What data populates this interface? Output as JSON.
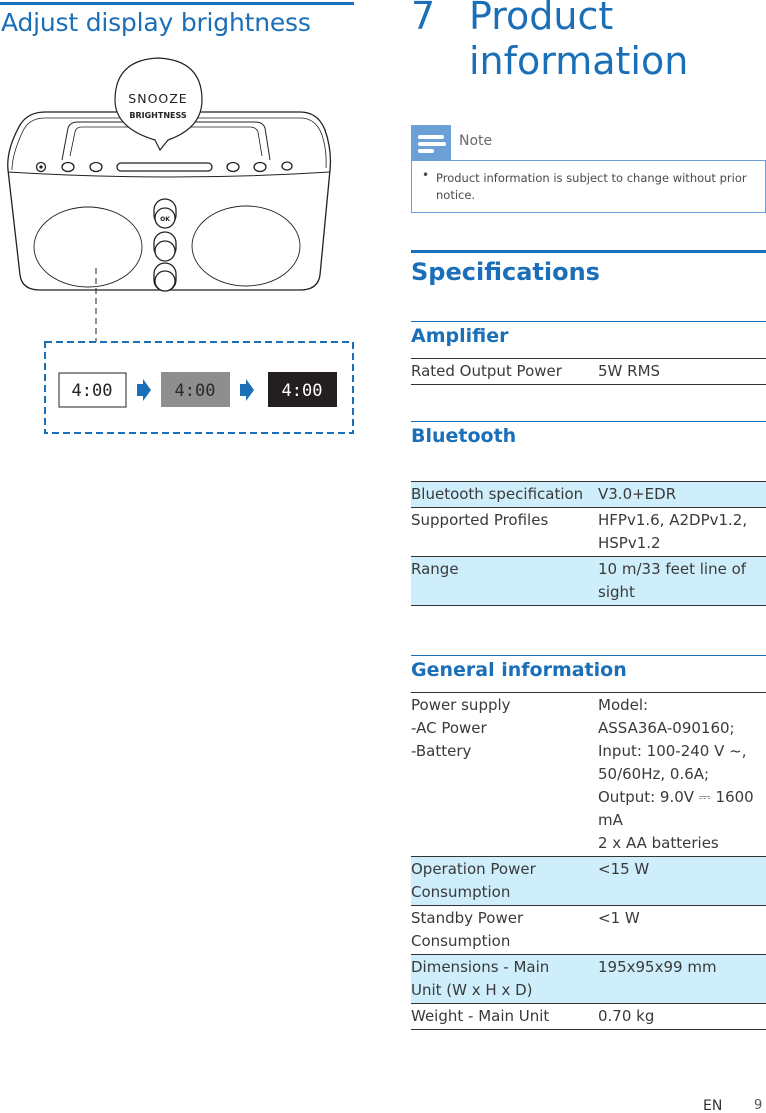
{
  "left": {
    "title": "Adjust display brightness",
    "illustration": {
      "callout_line1": "SNOOZE",
      "callout_line2": "BRIGHTNESS",
      "knob_label": "OK",
      "display_time": "4:00",
      "display_states": [
        "bright",
        "dim",
        "off"
      ],
      "arrow_icon": "right-arrow-icon"
    }
  },
  "right": {
    "chapter_number": "7",
    "chapter_title": "Product information",
    "note": {
      "label": "Note",
      "icon": "note-lines-icon",
      "bullet": "•",
      "text": "Product information is subject to change without prior notice."
    },
    "specs_title": "Specifications",
    "amplifier": {
      "title": "Amplifier",
      "rows": [
        {
          "label": "Rated Output Power",
          "value": [
            "5W RMS"
          ]
        }
      ]
    },
    "bluetooth": {
      "title": "Bluetooth",
      "rows": [
        {
          "label": [
            "Bluetooth specification"
          ],
          "value": [
            "V3.0+EDR"
          ]
        },
        {
          "label": [
            "Supported Profiles"
          ],
          "value": [
            "HFPv1.6, A2DPv1.2,",
            "HSPv1.2"
          ]
        },
        {
          "label": [
            "Range"
          ],
          "value": [
            "10 m/33 feet line of",
            "sight"
          ]
        }
      ]
    },
    "general": {
      "title": "General information",
      "rows": [
        {
          "label": [
            "Power supply",
            "-AC Power",
            "-Battery"
          ],
          "value": [
            "Model:",
            "ASSA36A-090160;",
            "Input: 100-240 V ~,",
            "50/60Hz, 0.6A;",
            "Output: 9.0V ⎓ 1600",
            "mA",
            "2 x AA batteries"
          ]
        },
        {
          "label": [
            "Operation Power",
            "Consumption"
          ],
          "value": [
            "<15 W"
          ]
        },
        {
          "label": [
            "Standby Power",
            "Consumption"
          ],
          "value": [
            "<1 W"
          ]
        },
        {
          "label": [
            "Dimensions - Main",
            "Unit (W x H x D)"
          ],
          "value": [
            "195x95x99 mm"
          ]
        },
        {
          "label": [
            "Weight - Main Unit"
          ],
          "value": [
            "0.70 kg"
          ]
        }
      ]
    }
  },
  "footer": {
    "language": "EN",
    "page_number": "9"
  },
  "colors": {
    "accent_blue": "#1a6fb8",
    "note_blue": "#6b9fd6",
    "row_shade": "#cdeefa",
    "dim_display": "#8e8e8e",
    "dark_display": "#231f20"
  }
}
